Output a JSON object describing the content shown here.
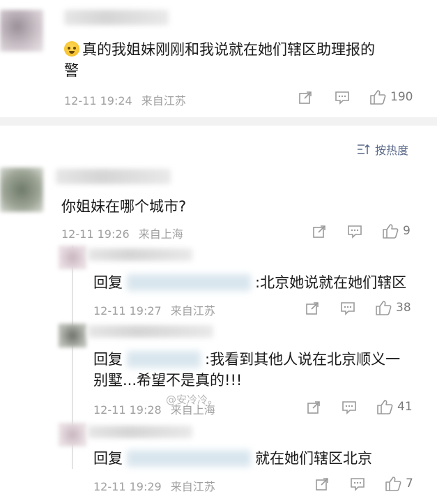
{
  "top_comment": {
    "emoji": "cry-emoji",
    "text_line1": "真的我姐妹刚刚和我说就在她们辖区助理报的",
    "text_line2": "警",
    "time": "12-11 19:24",
    "location": "来自江苏",
    "likes": "190"
  },
  "sort": {
    "label": "按热度"
  },
  "comment2": {
    "text": "你姐妹在哪个城市?",
    "time": "12-11 19:26",
    "location": "来自上海",
    "likes": "9"
  },
  "replies": [
    {
      "prefix": "回复",
      "text": ":北京她说就在她们辖区",
      "time": "12-11 19:27",
      "location": "来自江苏",
      "likes": "38"
    },
    {
      "prefix": "回复",
      "text": ":我看到其他人说在北京顺义一",
      "text_line2": "别墅...希望不是真的!!!",
      "time": "12-11 19:28",
      "location": "来自上海",
      "likes": "41"
    },
    {
      "prefix": "回复",
      "text": "就在她们辖区北京",
      "time": "12-11 19:29",
      "location": "来自江苏",
      "likes": "7"
    }
  ],
  "watermark": "@安冷冷。",
  "colors": {
    "divider": "#f2f2f2",
    "meta": "#a0a0a0",
    "icon": "#9a9a9a",
    "sort": "#5b6a8a"
  }
}
